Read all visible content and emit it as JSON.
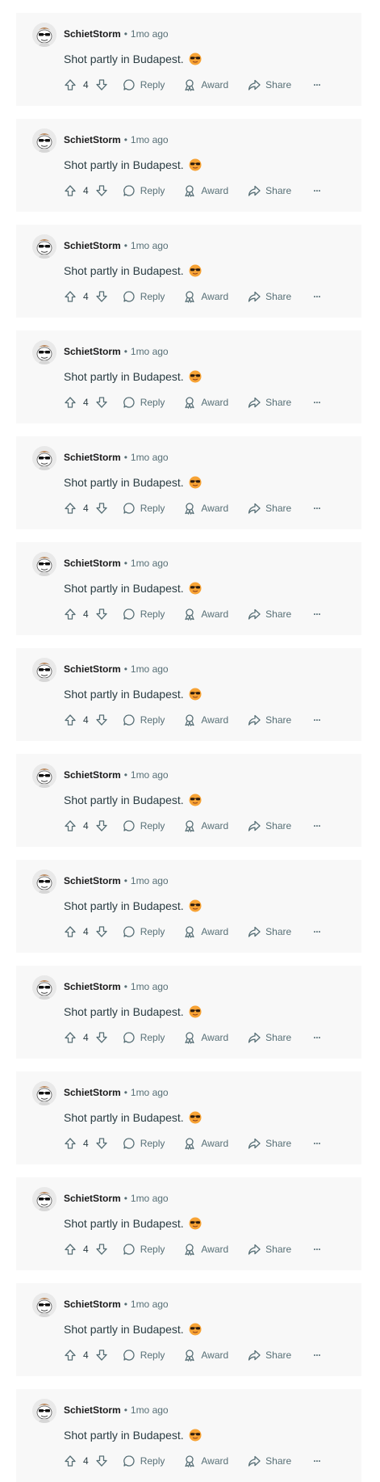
{
  "comments": [
    {
      "username": "SchietStorm",
      "separator": "•",
      "time": "1mo ago",
      "text": "Shot partly in Budapest.",
      "score": "4",
      "reply_label": "Reply",
      "award_label": "Award",
      "share_label": "Share",
      "more_label": "···"
    },
    {
      "username": "SchietStorm",
      "separator": "•",
      "time": "1mo ago",
      "text": "Shot partly in Budapest.",
      "score": "4",
      "reply_label": "Reply",
      "award_label": "Award",
      "share_label": "Share",
      "more_label": "···"
    },
    {
      "username": "SchietStorm",
      "separator": "•",
      "time": "1mo ago",
      "text": "Shot partly in Budapest.",
      "score": "4",
      "reply_label": "Reply",
      "award_label": "Award",
      "share_label": "Share",
      "more_label": "···"
    },
    {
      "username": "SchietStorm",
      "separator": "•",
      "time": "1mo ago",
      "text": "Shot partly in Budapest.",
      "score": "4",
      "reply_label": "Reply",
      "award_label": "Award",
      "share_label": "Share",
      "more_label": "···"
    },
    {
      "username": "SchietStorm",
      "separator": "•",
      "time": "1mo ago",
      "text": "Shot partly in Budapest.",
      "score": "4",
      "reply_label": "Reply",
      "award_label": "Award",
      "share_label": "Share",
      "more_label": "···"
    },
    {
      "username": "SchietStorm",
      "separator": "•",
      "time": "1mo ago",
      "text": "Shot partly in Budapest.",
      "score": "4",
      "reply_label": "Reply",
      "award_label": "Award",
      "share_label": "Share",
      "more_label": "···"
    },
    {
      "username": "SchietStorm",
      "separator": "•",
      "time": "1mo ago",
      "text": "Shot partly in Budapest.",
      "score": "4",
      "reply_label": "Reply",
      "award_label": "Award",
      "share_label": "Share",
      "more_label": "···"
    },
    {
      "username": "SchietStorm",
      "separator": "•",
      "time": "1mo ago",
      "text": "Shot partly in Budapest.",
      "score": "4",
      "reply_label": "Reply",
      "award_label": "Award",
      "share_label": "Share",
      "more_label": "···"
    },
    {
      "username": "SchietStorm",
      "separator": "•",
      "time": "1mo ago",
      "text": "Shot partly in Budapest.",
      "score": "4",
      "reply_label": "Reply",
      "award_label": "Award",
      "share_label": "Share",
      "more_label": "···"
    },
    {
      "username": "SchietStorm",
      "separator": "•",
      "time": "1mo ago",
      "text": "Shot partly in Budapest.",
      "score": "4",
      "reply_label": "Reply",
      "award_label": "Award",
      "share_label": "Share",
      "more_label": "···"
    },
    {
      "username": "SchietStorm",
      "separator": "•",
      "time": "1mo ago",
      "text": "Shot partly in Budapest.",
      "score": "4",
      "reply_label": "Reply",
      "award_label": "Award",
      "share_label": "Share",
      "more_label": "···"
    },
    {
      "username": "SchietStorm",
      "separator": "•",
      "time": "1mo ago",
      "text": "Shot partly in Budapest.",
      "score": "4",
      "reply_label": "Reply",
      "award_label": "Award",
      "share_label": "Share",
      "more_label": "···"
    },
    {
      "username": "SchietStorm",
      "separator": "•",
      "time": "1mo ago",
      "text": "Shot partly in Budapest.",
      "score": "4",
      "reply_label": "Reply",
      "award_label": "Award",
      "share_label": "Share",
      "more_label": "···"
    },
    {
      "username": "SchietStorm",
      "separator": "•",
      "time": "1mo ago",
      "text": "Shot partly in Budapest.",
      "score": "4",
      "reply_label": "Reply",
      "award_label": "Award",
      "share_label": "Share",
      "more_label": "···"
    }
  ],
  "icons": {
    "avatar": "snoo-avatar-sunglasses-icon",
    "emoji": "sunglasses-face-emoji-icon",
    "upvote": "arrow-up-outline-icon",
    "downvote": "arrow-down-outline-icon",
    "reply": "speech-bubble-icon",
    "award": "award-ribbon-icon",
    "share": "share-arrow-icon",
    "more": "ellipsis-icon"
  },
  "colors": {
    "card_background": "#f8f8f8",
    "meta_text": "#576f76",
    "username_text": "#1a1a1b",
    "body_text": "#2a3c42"
  }
}
